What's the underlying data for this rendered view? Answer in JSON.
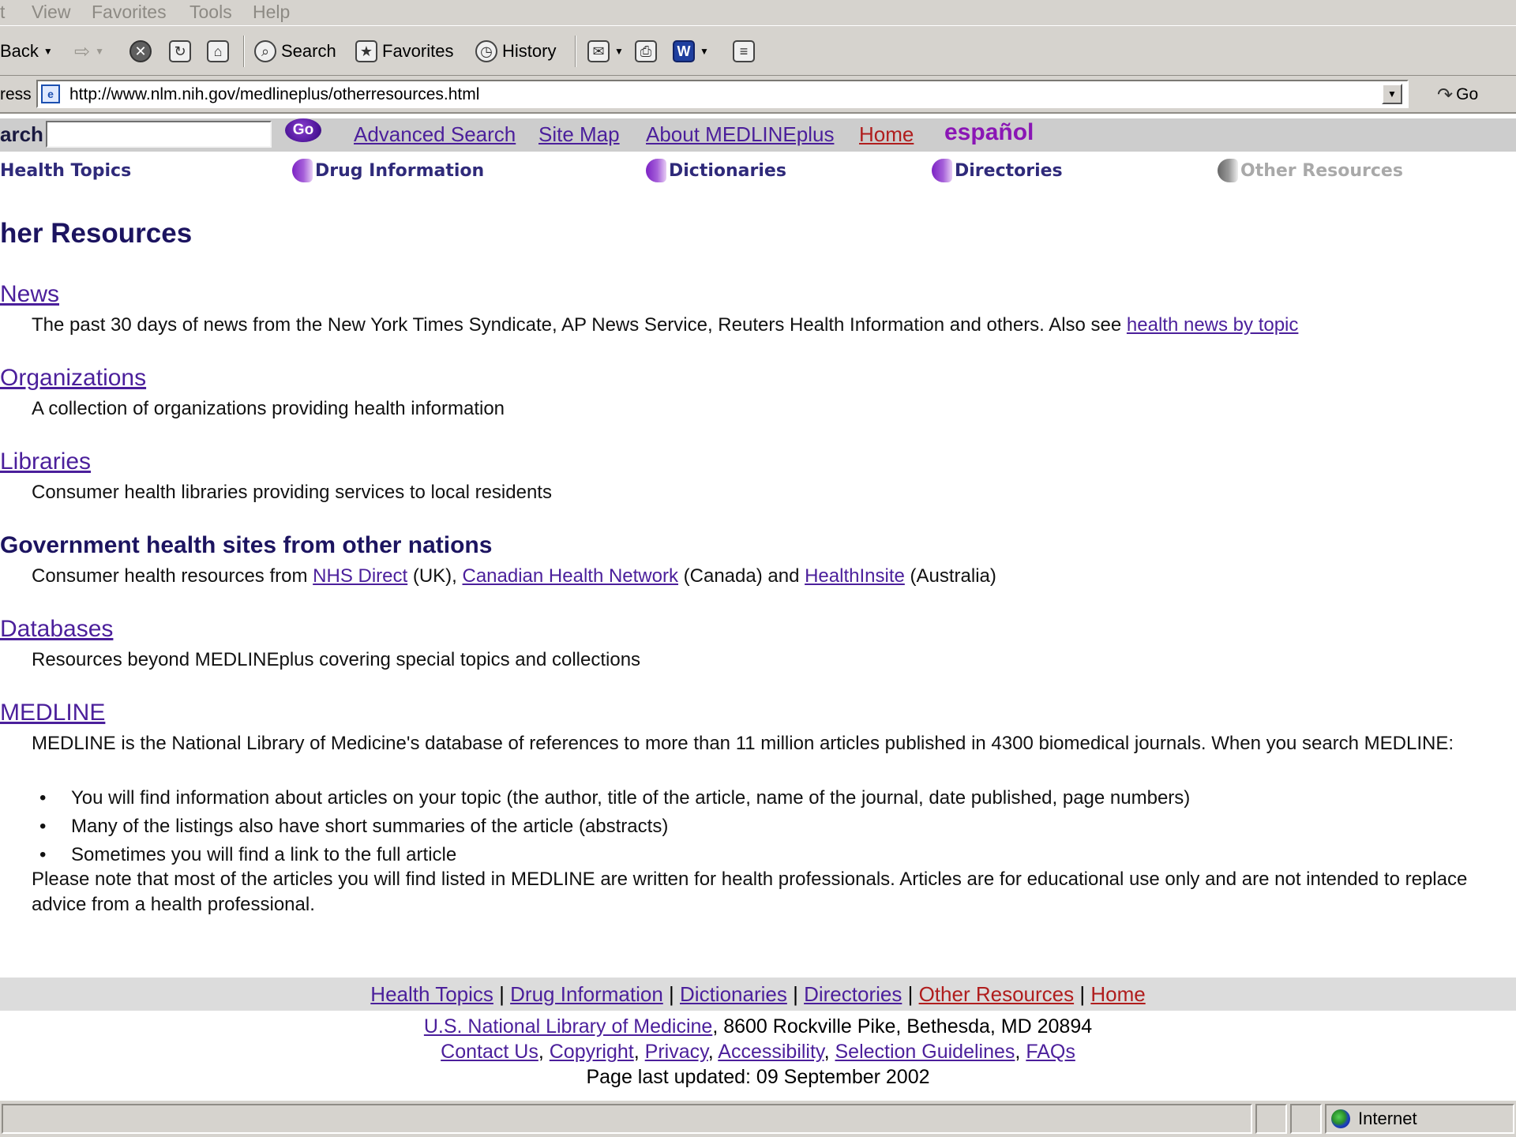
{
  "browser": {
    "menu": [
      "t",
      "View",
      "Favorites",
      "Tools",
      "Help"
    ],
    "toolbar": {
      "back": "Back",
      "search": "Search",
      "favorites": "Favorites",
      "history": "History"
    },
    "address_label": "ress",
    "url": "http://www.nlm.nih.gov/medlineplus/otherresources.html",
    "go": "Go",
    "status_zone": "Internet"
  },
  "site": {
    "search_label": "arch",
    "search_value": "",
    "go_button": "Go",
    "top_links": {
      "advanced": "Advanced Search",
      "sitemap": "Site Map",
      "about": "About MEDLINEplus",
      "home": "Home",
      "espanol": "español"
    },
    "tabs": [
      "Health Topics",
      "Drug Information",
      "Dictionaries",
      "Directories",
      "Other Resources"
    ],
    "colors": {
      "link": "#4b1f9b",
      "home_link": "#b01d1d",
      "espanol": "#8a16b5",
      "tab_text": "#2f2a7a"
    }
  },
  "content": {
    "title": "her Resources",
    "news": {
      "heading": "News",
      "text": "The past 30 days of news from the New York Times Syndicate, AP News Service, Reuters Health Information and others. Also see ",
      "link": "health news by topic"
    },
    "organizations": {
      "heading": "Organizations",
      "text": "A collection of organizations providing health information"
    },
    "libraries": {
      "heading": "Libraries",
      "text": "Consumer health libraries providing services to local residents"
    },
    "government": {
      "heading": "Government health sites from other nations",
      "text_prefix": "Consumer health resources from ",
      "link1": "NHS Direct",
      "text_mid1": " (UK), ",
      "link2": "Canadian Health Network",
      "text_mid2": " (Canada) and ",
      "link3": "HealthInsite",
      "text_suffix": " (Australia)"
    },
    "databases": {
      "heading": "Databases",
      "text": "Resources beyond MEDLINEplus covering special topics and collections"
    },
    "medline": {
      "heading": "MEDLINE",
      "intro": "MEDLINE is the National Library of Medicine's database of references to more than 11 million articles published in 4300 biomedical journals. When you search MEDLINE:",
      "bullets": [
        "You will find information about articles on your topic (the author, title of the article, name of the journal, date published, page numbers)",
        "Many of the listings also have short summaries of the article (abstracts)",
        "Sometimes you will find a link to the full article"
      ],
      "note": "Please note that most of the articles you will find listed in MEDLINE are written for health professionals. Articles are for educational use only and are not intended to replace advice from a health professional."
    }
  },
  "footer": {
    "nav": [
      "Health Topics",
      "Drug Information",
      "Dictionaries",
      "Directories",
      "Other Resources",
      "Home"
    ],
    "separator": "|",
    "nlm_link": "U.S. National Library of Medicine",
    "address": ", 8600 Rockville Pike, Bethesda, MD 20894",
    "links": [
      "Contact Us",
      "Copyright",
      "Privacy",
      "Accessibility",
      "Selection Guidelines",
      "FAQs"
    ],
    "comma": ", ",
    "updated": "Page last updated: 09 September 2002"
  }
}
